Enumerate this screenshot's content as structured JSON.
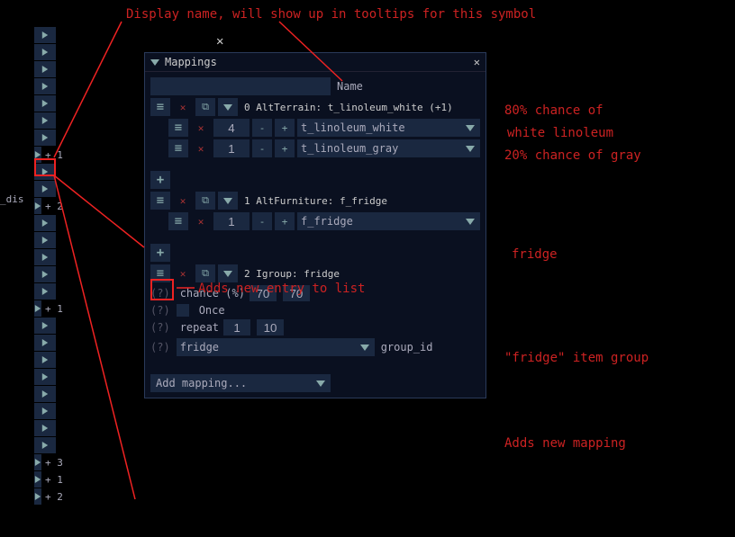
{
  "panel": {
    "title": "Mappings",
    "name_label": "Name",
    "name_value": ""
  },
  "sidebar": {
    "items": [
      {
        "label": ""
      },
      {
        "label": ""
      },
      {
        "label": ""
      },
      {
        "label": ""
      },
      {
        "label": ""
      },
      {
        "label": ""
      },
      {
        "label": ""
      },
      {
        "label": "+ 1"
      },
      {
        "label": ""
      },
      {
        "label": ""
      },
      {
        "label": "+ 2"
      },
      {
        "label": ""
      },
      {
        "label": ""
      },
      {
        "label": ""
      },
      {
        "label": ""
      },
      {
        "label": ""
      },
      {
        "label": "+ 1"
      },
      {
        "label": ""
      },
      {
        "label": ""
      },
      {
        "label": ""
      },
      {
        "label": ""
      },
      {
        "label": ""
      },
      {
        "label": ""
      },
      {
        "label": ""
      },
      {
        "label": ""
      },
      {
        "label": "+ 3"
      },
      {
        "label": "+ 1"
      },
      {
        "label": "+ 2"
      }
    ],
    "dis_label": "_dis"
  },
  "mappings": [
    {
      "index": "0",
      "header": "0 AltTerrain: t_linoleum_white (+1)",
      "rows": [
        {
          "weight": "4",
          "value": "t_linoleum_white"
        },
        {
          "weight": "1",
          "value": "t_linoleum_gray"
        }
      ]
    },
    {
      "index": "1",
      "header": "1 AltFurniture: f_fridge",
      "rows": [
        {
          "weight": "1",
          "value": "f_fridge"
        }
      ]
    },
    {
      "index": "2",
      "header": "2 Igroup: fridge",
      "chance_label": "chance (%)",
      "chance1": "70",
      "chance2": "70",
      "once_label": "Once",
      "repeat_label": "repeat",
      "repeat1": "1",
      "repeat2": "10",
      "group_value": "fridge",
      "group_id_label": "group_id"
    }
  ],
  "add_mapping": "Add mapping...",
  "annotations": {
    "a1": "Display name, will show up in tooltips for this symbol",
    "a2": "80% chance of",
    "a3": "white linoleum",
    "a4": "20% chance of gray",
    "a5": "fridge",
    "a6": "Adds new entry to list",
    "a7": "\"fridge\" item group",
    "a8": "Adds new mapping"
  }
}
